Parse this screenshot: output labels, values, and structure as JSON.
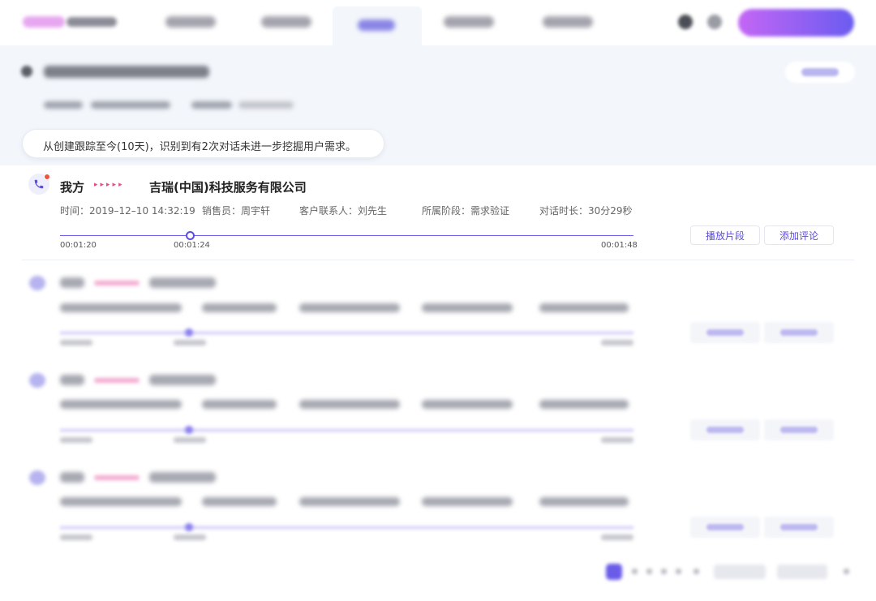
{
  "notice": {
    "text": "从创建跟踪至今(10天)，识别到有2次对话未进一步挖掘用户需求。"
  },
  "record": {
    "party_self": "我方",
    "arrows": "▸▸▸▸▸",
    "company": "吉瑞(中国)科技服务有限公司",
    "time": "时间：2019–12–10 14:32:19",
    "salesperson": "销售员：周宇轩",
    "contact": "客户联系人：刘先生",
    "stage": "所属阶段：需求验证",
    "duration": "对话时长：30分29秒",
    "timestamp_start": "00:01:20",
    "timestamp_current": "00:01:24",
    "timestamp_end": "00:01:48",
    "play_button": "播放片段",
    "comment_button": "添加评论"
  },
  "icons": {
    "phone": "phone-icon",
    "notification": "notification-dot-icon",
    "back": "back-arrow-icon"
  },
  "colors": {
    "accent": "#5b4ce4",
    "arrow": "#e34c8c",
    "band": "#f3f6fb",
    "alert_dot": "#f0523e"
  }
}
